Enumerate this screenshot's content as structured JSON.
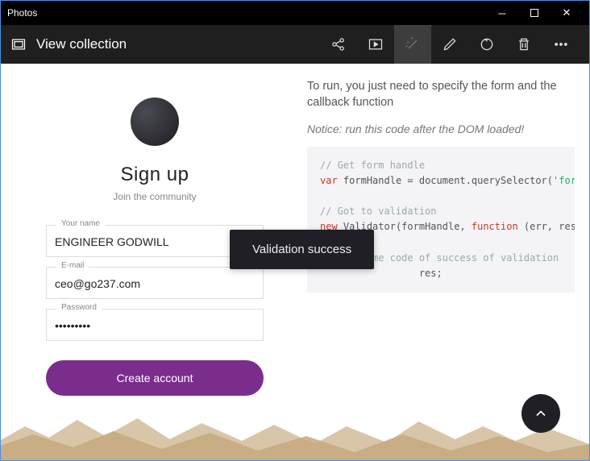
{
  "window": {
    "title": "Photos"
  },
  "toolbar": {
    "title": "View collection"
  },
  "signup": {
    "title": "Sign up",
    "subtitle": "Join the community",
    "fields": {
      "name": {
        "label": "Your name",
        "value": "ENGINEER GODWILL"
      },
      "email": {
        "label": "E-mail",
        "value": "ceo@go237.com"
      },
      "password": {
        "label": "Password",
        "value": "•••••••••"
      }
    },
    "submit_label": "Create account"
  },
  "doc": {
    "description": "To run, you just need to specify the form and the callback function",
    "notice": "Notice: run this code after the DOM loaded!",
    "code": {
      "l1": "// Get form handle",
      "kw_var": "var",
      "l2a": "formHandle = document.querySelector(",
      "l2b": "'form[name=\"demo",
      "l3": "// Got to validation",
      "kw_new": "new",
      "l4a": "Validator(formHandle, ",
      "kw_func": "function",
      "l4b": "(err, res) {",
      "l5": "// some code of success of validation",
      "l6": "res;"
    }
  },
  "toast": {
    "message": "Validation success"
  }
}
